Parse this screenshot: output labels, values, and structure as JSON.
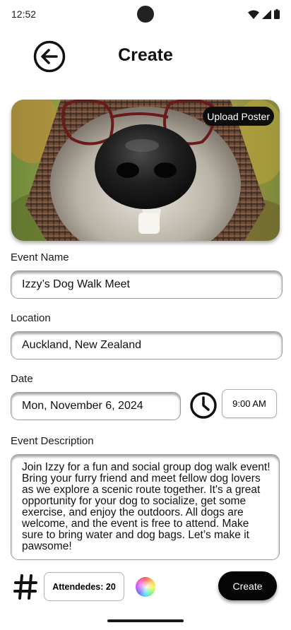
{
  "status_bar": {
    "time": "12:52"
  },
  "header": {
    "title": "Create"
  },
  "poster": {
    "upload_label": "Upload Poster"
  },
  "form": {
    "event_name_label": "Event Name",
    "event_name_value": "Izzy’s Dog Walk Meet",
    "location_label": "Location",
    "location_value": "Auckland, New Zealand",
    "date_label": "Date",
    "date_value": "Mon, November 6, 2024",
    "time_value": "9:00 AM",
    "description_label": "Event Description",
    "description_value": "Join Izzy for a fun and social group dog walk event! Bring your furry friend and meet fellow dog lovers as we explore a scenic route together. It's a great opportunity for your dog to socialize, get some exercise, and enjoy the outdoors. All dogs are welcome, and the event is free to attend. Make sure to bring water and dog bags. Let’s make it pawsome!"
  },
  "footer": {
    "attendees_label": "Attendedes: 20",
    "create_label": "Create"
  }
}
